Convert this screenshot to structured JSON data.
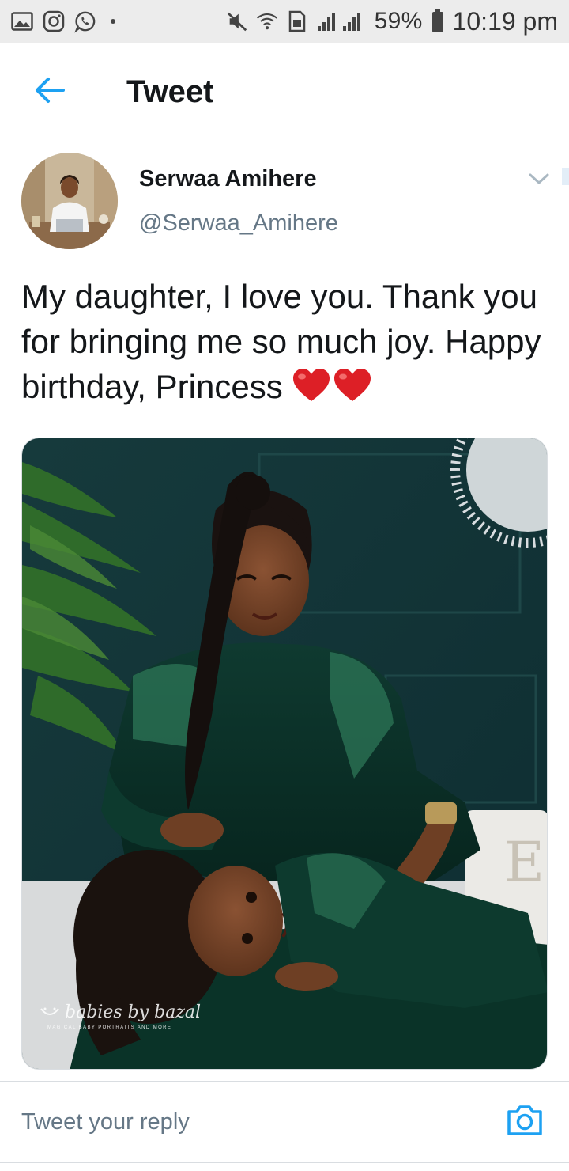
{
  "status_bar": {
    "battery": "59%",
    "time": "10:19 pm",
    "icons": [
      "gallery-icon",
      "instagram-icon",
      "whatsapp-icon",
      "mute-icon",
      "wifi-icon",
      "sim-icon",
      "signal-icon",
      "battery-icon"
    ]
  },
  "header": {
    "title": "Tweet",
    "back_icon": "back-arrow-icon",
    "accent_color": "#1da1f2"
  },
  "tweet": {
    "author_name": "Serwaa Amihere",
    "author_handle": "@Serwaa_Amihere",
    "text": "My daughter, I love you. Thank you for bringing me so much joy. Happy birthday, Princess",
    "emoji": [
      "red-heart-icon",
      "red-heart-icon"
    ],
    "media": {
      "watermark": "babies by bazal",
      "watermark_tagline": "MAGICAL BABY PORTRAITS AND MORE"
    }
  },
  "reply": {
    "placeholder": "Tweet your reply",
    "camera_icon": "camera-icon"
  }
}
